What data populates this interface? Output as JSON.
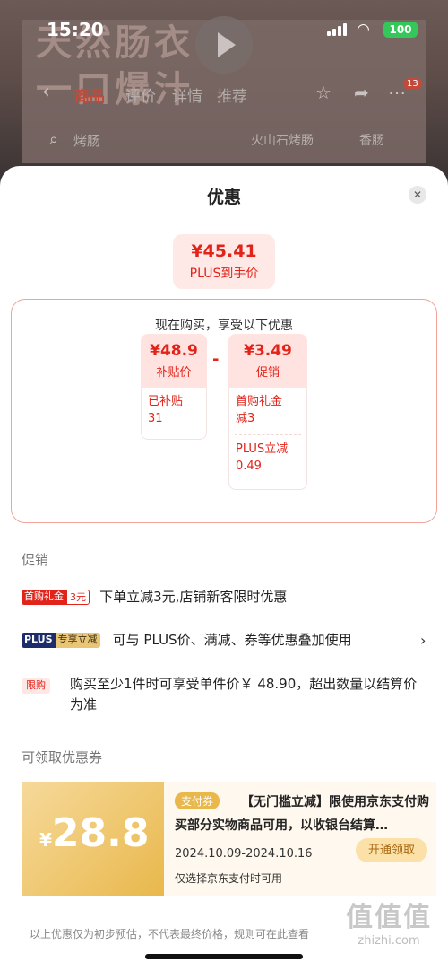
{
  "status_bar": {
    "time": "15:20",
    "battery": "100"
  },
  "background": {
    "banner_text_line1": "天然肠衣",
    "banner_text_line2": "一口爆汁",
    "tabs": [
      "商品",
      "评价",
      "详情",
      "推荐"
    ],
    "cart_badge": "13",
    "search_text": "烤肠",
    "search_chips": [
      "火山石烤肠",
      "香肠"
    ]
  },
  "sheet": {
    "title": "优惠",
    "plus_price": "¥45.41",
    "plus_price_label": "PLUS到手价",
    "breakdown_heading": "现在购买，享受以下优惠",
    "subsidy_card": {
      "price": "¥48.9",
      "label": "补贴价",
      "lines": [
        "已补贴",
        "31"
      ]
    },
    "minus": "-",
    "promo_card": {
      "price": "¥3.49",
      "label": "促销",
      "items": [
        [
          "首购礼金",
          "减3"
        ],
        [
          "PLUS立减",
          "0.49"
        ]
      ]
    }
  },
  "promotions": {
    "title": "促销",
    "items": [
      {
        "tag1": "首购礼金",
        "tag2": "3元",
        "text": "下单立减3元,店铺新客限时优惠"
      },
      {
        "tag1": "PLUS",
        "tag2": "专享立减",
        "text": "可与 PLUS价、满减、券等优惠叠加使用"
      },
      {
        "tag1": "限购",
        "text": "购买至少1件时可享受单件价￥ 48.90，超出数量以结算价为准"
      }
    ]
  },
  "coupons": {
    "title": "可领取优惠券",
    "coupon": {
      "yen": "¥",
      "amount": "28.8",
      "tag": "支付券",
      "description": "【无门槛立减】限使用京东支付购买部分实物商品可用，以收银台结算…",
      "date_range": "2024.10.09-2024.10.16",
      "button": "开通领取",
      "note": "仅选择京东支付时可用"
    }
  },
  "footer_note": "以上优惠仅为初步预估，不代表最终价格，规则可在此查看",
  "watermark": {
    "logo": "值值值",
    "site": "zhizhi.com"
  },
  "colors": {
    "accent_red": "#e2231a",
    "plus_navy": "#1d2d6b",
    "gold": "#e9b84c"
  }
}
